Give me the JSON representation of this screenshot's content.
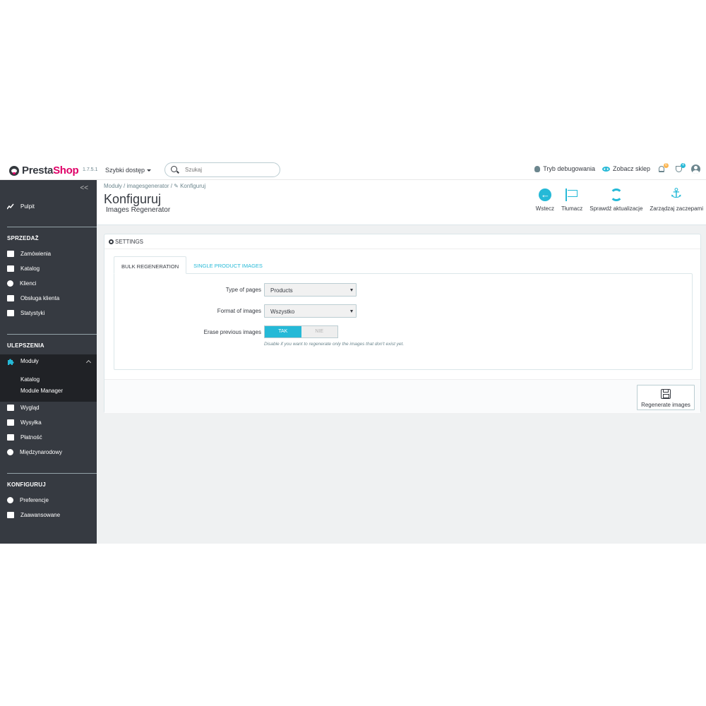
{
  "header": {
    "logo_prefix": "Presta",
    "logo_suffix": "Shop",
    "version": "1.7.5.1",
    "quick_access": "Szybki dostęp",
    "search_placeholder": "Szukaj",
    "debug_mode": "Tryb debugowania",
    "view_shop": "Zobacz sklep",
    "notif_badge_1": "6",
    "notif_badge_2": "4",
    "accent_color": "#25b9d7"
  },
  "sidebar": {
    "collapse": "<<",
    "dashboard": "Pulpit",
    "sections": [
      {
        "title": "SPRZEDAŻ",
        "items": [
          "Zamówienia",
          "Katalog",
          "Klienci",
          "Obsługa klienta",
          "Statystyki"
        ]
      },
      {
        "title": "ULEPSZENIA",
        "items": [
          "Moduły"
        ],
        "subitems": [
          "Katalog",
          "Module Manager"
        ],
        "after": [
          "Wygląd",
          "Wysyłka",
          "Płatność",
          "Międzynarodowy"
        ]
      },
      {
        "title": "KONFIGURUJ",
        "items": [
          "Preferencje",
          "Zaawansowane"
        ]
      }
    ]
  },
  "toolbar": {
    "breadcrumb": "Moduły  /  imagesgenerator  /  ✎ Konfiguruj",
    "title": "Konfiguruj",
    "subtitle": "Images Regenerator",
    "buttons": [
      "Wstecz",
      "Tłumacz",
      "Sprawdź aktualizacje",
      "Zarządzaj zaczepami"
    ]
  },
  "panel": {
    "heading": "SETTINGS",
    "tabs": [
      "BULK REGENERATION",
      "SINGLE PRODUCT IMAGES"
    ],
    "fields": {
      "type_label": "Type of pages",
      "type_value": "Products",
      "format_label": "Format of images",
      "format_value": "Wszystko",
      "erase_label": "Erase previous images",
      "erase_yes": "TAK",
      "erase_no": "NIE",
      "erase_help": "Disable if you want to regenerate only the images that don't exist yet."
    },
    "submit": "Regenerate images"
  }
}
